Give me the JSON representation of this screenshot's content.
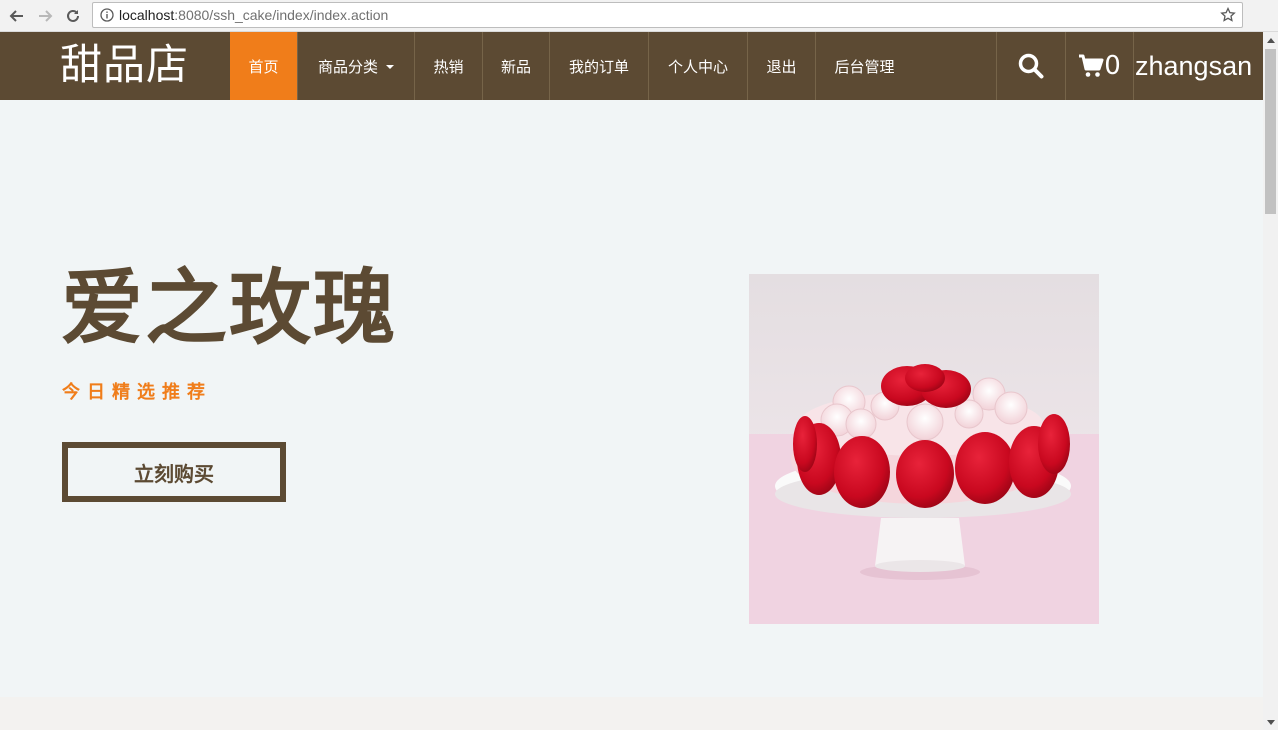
{
  "browser": {
    "url_host": "localhost",
    "url_rest": ":8080/ssh_cake/index/index.action"
  },
  "site": {
    "brand": "甜品店",
    "menu": [
      {
        "label": "首页",
        "active": true
      },
      {
        "label": "商品分类",
        "dropdown": true
      },
      {
        "label": "热销"
      },
      {
        "label": "新品"
      },
      {
        "label": "我的订单"
      },
      {
        "label": "个人中心"
      },
      {
        "label": "退出"
      },
      {
        "label": "后台管理"
      }
    ],
    "cart_count": "0",
    "username": "zhangsan"
  },
  "hero": {
    "title": "爱之玫瑰",
    "subtitle": "今日精选推荐",
    "buy_label": "立刻购买"
  },
  "colors": {
    "nav_bg": "#5c4a33",
    "accent": "#f07d1a",
    "hero_bg": "#f1f5f6"
  },
  "icons": {
    "back": "arrow-left-icon",
    "forward": "arrow-right-icon",
    "reload": "reload-icon",
    "info": "info-icon",
    "bookmark": "star-icon",
    "search": "search-icon",
    "cart": "cart-icon"
  }
}
